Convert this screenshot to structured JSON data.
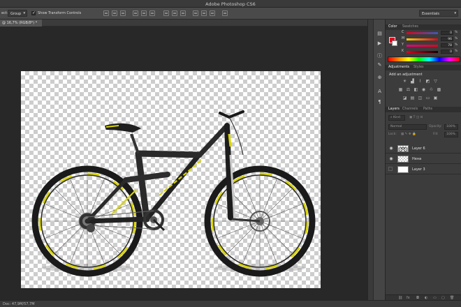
{
  "app": {
    "title": "Adobe Photoshop CS6"
  },
  "options_bar": {
    "auto_select_label": "ect:",
    "auto_select_value": "Group",
    "show_transform_label": "Show Transform Controls",
    "workspace": "Essentials"
  },
  "document": {
    "tab_label": "@ 16,7% (RGB/8*) *",
    "zoom": "16,7%",
    "color_mode": "RGB/8"
  },
  "status": {
    "doc_size": "Doc: 47,9M/57,7M"
  },
  "colors": {
    "foreground": "#e3001b",
    "background": "#ffffff",
    "accent_yellow": "#d9d400"
  },
  "color_panel": {
    "tabs": [
      "Color",
      "Swatches"
    ],
    "channels": [
      {
        "label": "C",
        "value": "0"
      },
      {
        "label": "M",
        "value": "96"
      },
      {
        "label": "Y",
        "value": "78"
      },
      {
        "label": "K",
        "value": "0"
      }
    ],
    "percent": "%"
  },
  "adjustments_panel": {
    "tabs": [
      "Adjustments",
      "Styles"
    ],
    "title": "Add an adjustment"
  },
  "layers_panel": {
    "tabs": [
      "Layers",
      "Channels",
      "Paths"
    ],
    "filter_kind": "Kind",
    "blend_mode": "Normal",
    "opacity_label": "Opacity:",
    "opacity_value": "100%",
    "lock_label": "Lock:",
    "fill_label": "Fill:",
    "fill_value": "100%",
    "layers": [
      {
        "name": "Layer 6",
        "visible": true
      },
      {
        "name": "Нена",
        "visible": true
      },
      {
        "name": "Layer 3",
        "visible": false
      }
    ]
  }
}
